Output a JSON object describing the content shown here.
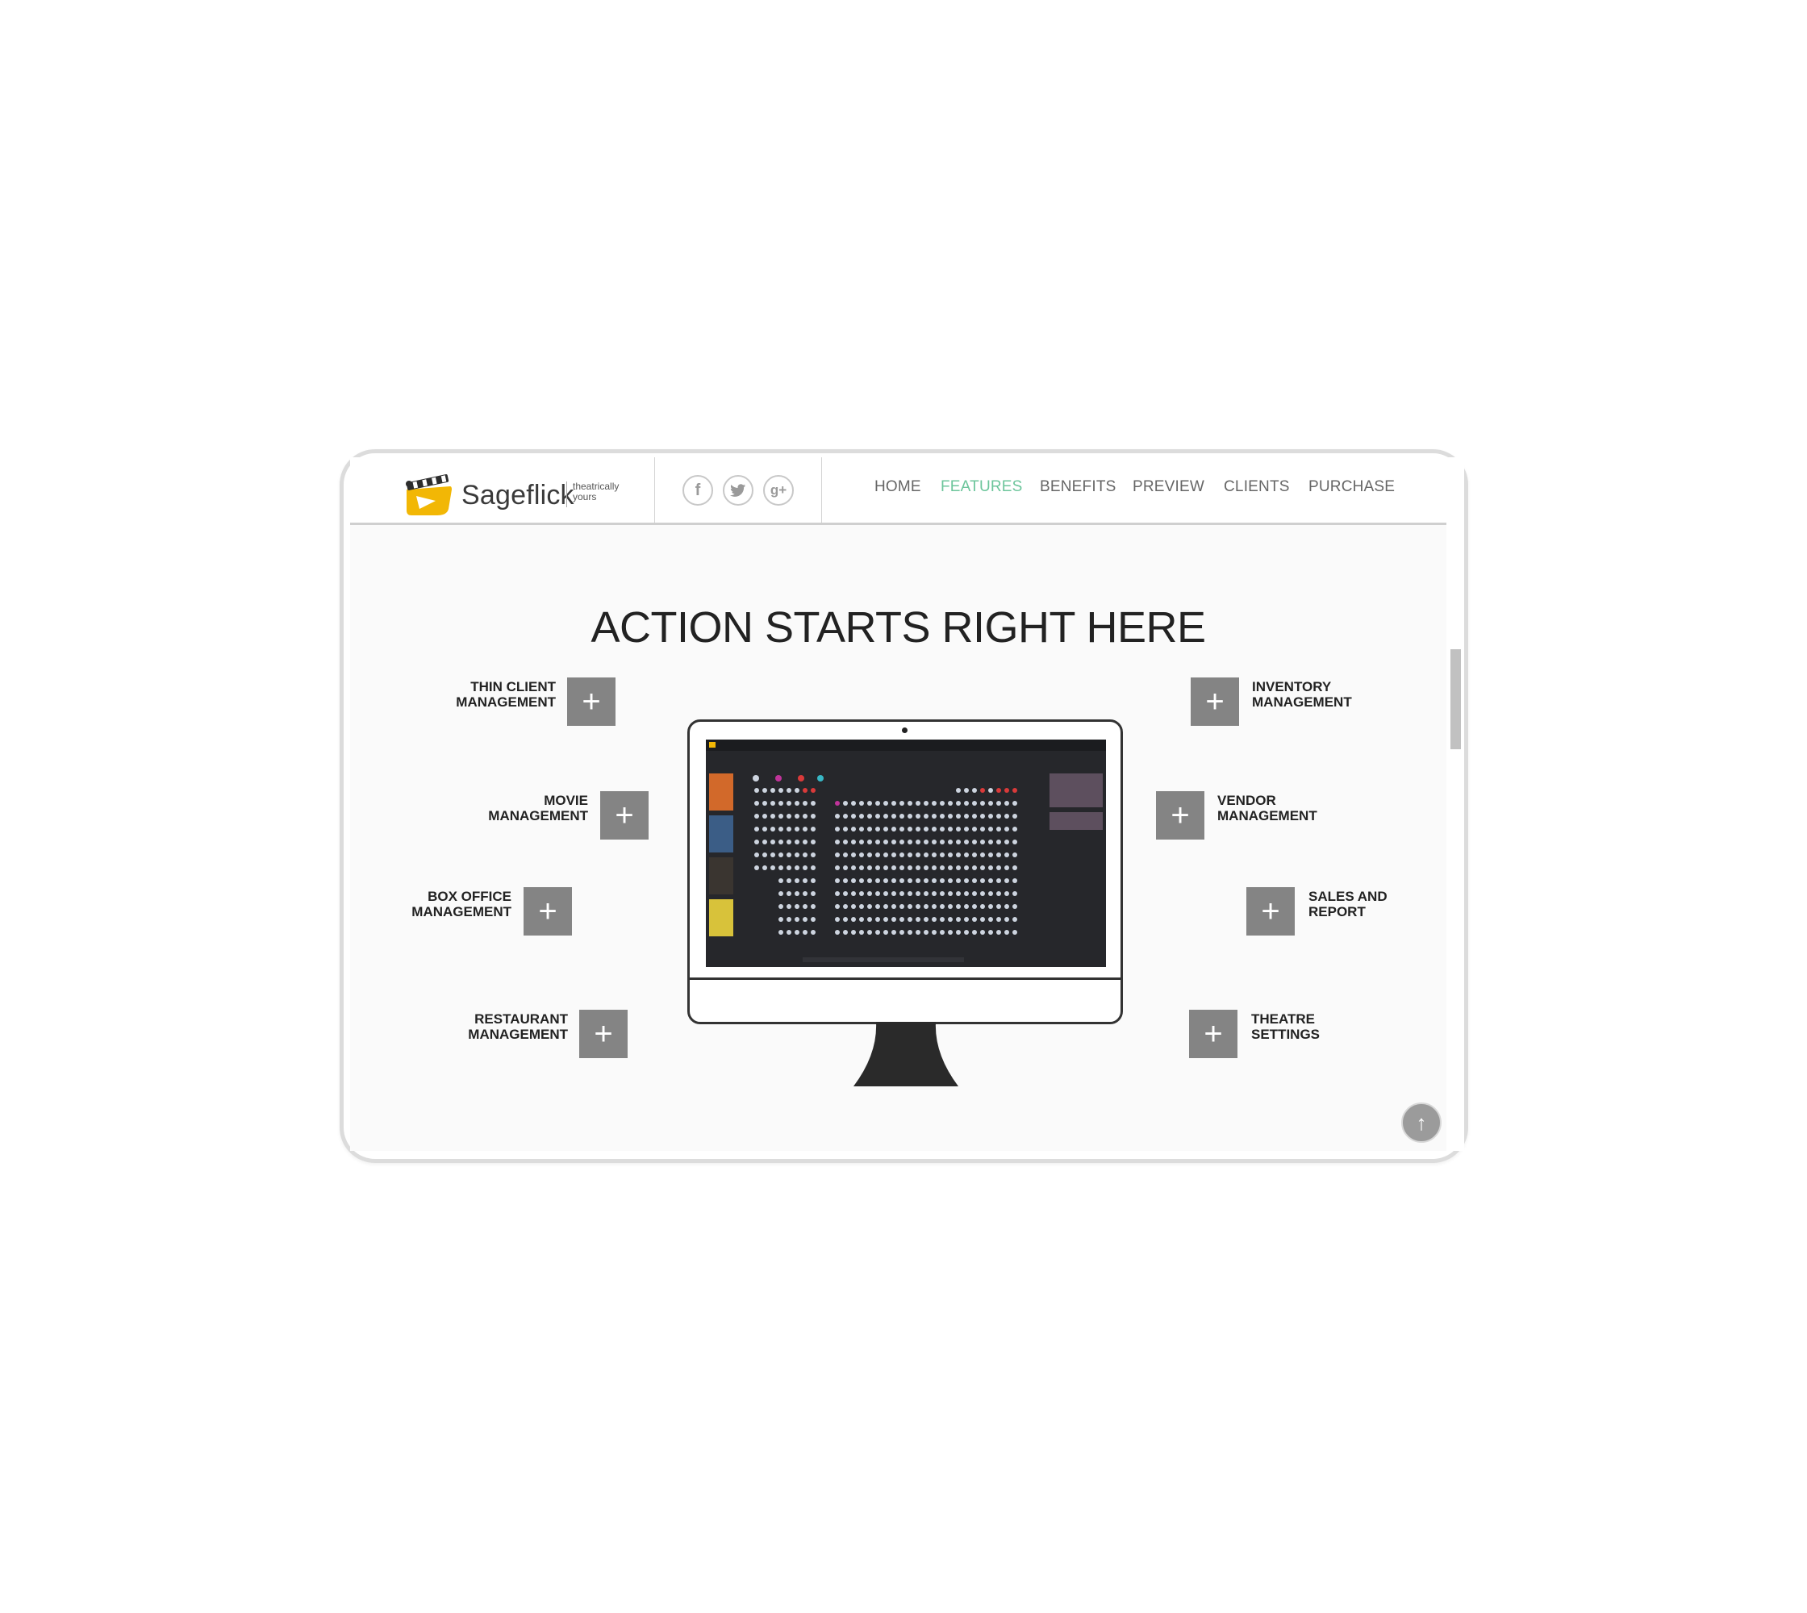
{
  "brand": {
    "name": "Sageflick",
    "tagline_1": "theatrically",
    "tagline_2": "yours"
  },
  "social": [
    {
      "icon": "facebook-icon",
      "glyph": "f"
    },
    {
      "icon": "twitter-icon",
      "glyph": "t"
    },
    {
      "icon": "google-plus-icon",
      "glyph": "g+"
    }
  ],
  "nav": {
    "home": "HOME",
    "features": "FEATURES",
    "benefits": "BENEFITS",
    "preview": "PREVIEW",
    "clients": "CLIENTS",
    "purchase": "PURCHASE",
    "active": "FEATURES"
  },
  "headline": "ACTION STARTS RIGHT HERE",
  "features": {
    "thin_client": {
      "line1": "THIN CLIENT",
      "line2": "MANAGEMENT"
    },
    "movie": {
      "line1": "MOVIE",
      "line2": "MANAGEMENT"
    },
    "box_office": {
      "line1": "BOX OFFICE",
      "line2": "MANAGEMENT"
    },
    "restaurant": {
      "line1": "RESTAURANT",
      "line2": "MANAGEMENT"
    },
    "inventory": {
      "line1": "INVENTORY",
      "line2": "MANAGEMENT"
    },
    "vendor": {
      "line1": "VENDOR",
      "line2": "MANAGEMENT"
    },
    "sales": {
      "line1": "SALES AND",
      "line2": "REPORT"
    },
    "theatre": {
      "line1": "THEATRE",
      "line2": "SETTINGS"
    }
  },
  "plus_glyph": "+",
  "back_to_top_glyph": "↑",
  "colors": {
    "accent": "#6cc59b",
    "button": "#848484",
    "brand_yellow": "#f2b705"
  }
}
